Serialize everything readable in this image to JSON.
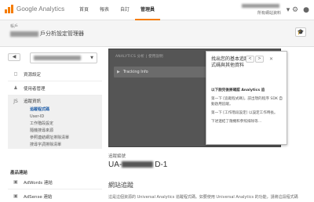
{
  "header": {
    "logo_text": "Google Analytics",
    "nav": [
      "首頁",
      "報表",
      "自訂",
      "管理員"
    ],
    "active_nav": "管理員",
    "account_sub": "所有網站資料",
    "icons": [
      "settings-gear-icon",
      "account-avatar-icon"
    ]
  },
  "admin": {
    "account_label": "帳戶",
    "property_name_visible": "戶分析設定管理器"
  },
  "left": {
    "back_label": "◀",
    "select_caret": "▼",
    "items": [
      {
        "icon": "◻",
        "label": "資源設定"
      },
      {
        "icon": "♟",
        "label": "使用者管理"
      }
    ],
    "group": {
      "icon": "JS",
      "label": "追蹤資訊",
      "subs": [
        "追蹤程式碼",
        "User-ID",
        "工作階段設定",
        "隨機搜尋來源",
        "參照連結網址排除清單",
        "搜尋字詞排除清單"
      ],
      "active_index": 0
    },
    "section_label": "產品連結",
    "bottom_items": [
      {
        "icon": "▣",
        "label": "AdWords 連結"
      },
      {
        "icon": "▣",
        "label": "AdSense 連結"
      }
    ]
  },
  "panel": {
    "head": "ANALYTICS 分析 | 使用說明",
    "row_label": "Tracking Info"
  },
  "tooltip": {
    "title": "找出您的基本追蹤程式碼與其他資料",
    "nav_prev": "<",
    "nav_next": ">",
    "close": "✕",
    "bold": "以下說完後將確認 Analytics 追",
    "p1": "第一下 [追蹤程式碼]，該出現的程序 SDK 自動啟用追蹤。",
    "p2": "第一下 [工作階段設定] 以設定工作時長。",
    "p3": "下述連結了隨機和參照排除等…"
  },
  "tracking": {
    "label": "追蹤編號",
    "id_prefix": "UA-",
    "id_suffix": "D-1"
  },
  "main": {
    "section_title": "網站追蹤",
    "desc": "這是這個資源的 Universal Analytics 追蹤程式碼。如要使用 Universal Analytics 的功能，請將這段程式碼"
  }
}
